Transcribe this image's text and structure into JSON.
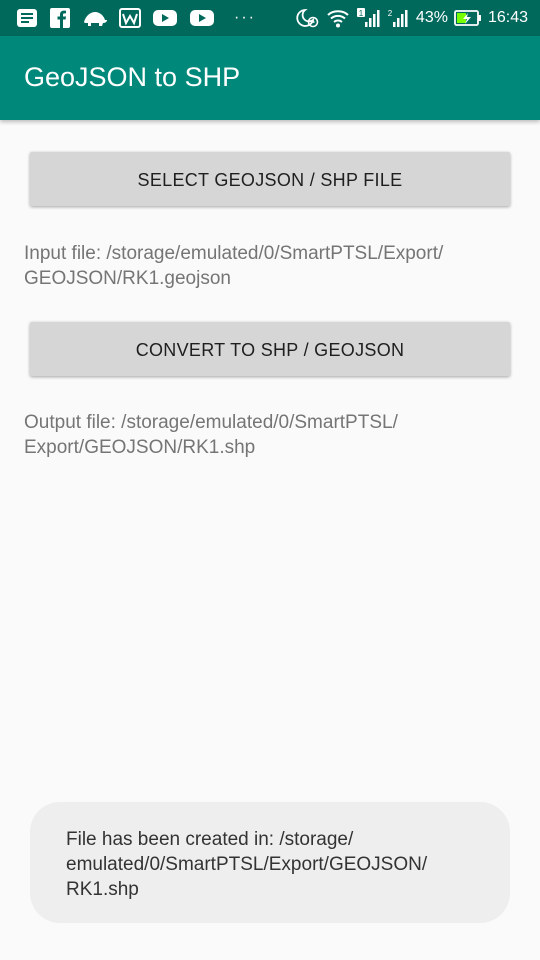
{
  "status_bar": {
    "left_icons": [
      "notes-icon",
      "facebook-icon",
      "turtle-icon",
      "wechat-icon",
      "youtube-icon",
      "youtube-icon"
    ],
    "overflow": "···",
    "right_icons": [
      "alarm-icon",
      "wifi-icon",
      "signal-sim1-icon",
      "signal-sim2-icon"
    ],
    "battery_percent": "43%",
    "time": "16:43"
  },
  "app_bar": {
    "title": "GeoJSON to SHP"
  },
  "main": {
    "select_button_label": "SELECT GEOJSON / SHP FILE",
    "input_file_text": "Input file: /storage/emulated/0/SmartPTSL/Export/\nGEOJSON/RK1.geojson",
    "convert_button_label": "CONVERT TO SHP / GEOJSON",
    "output_file_text": "Output file: /storage/emulated/0/SmartPTSL/\nExport/GEOJSON/RK1.shp"
  },
  "toast": {
    "message": "File has been created in: /storage/\nemulated/0/SmartPTSL/Export/GEOJSON/\nRK1.shp"
  },
  "colors": {
    "status_bar": "#00695c",
    "app_bar": "#00897b",
    "background": "#fafafa",
    "button": "#d6d6d6",
    "battery": "#76ff03"
  }
}
